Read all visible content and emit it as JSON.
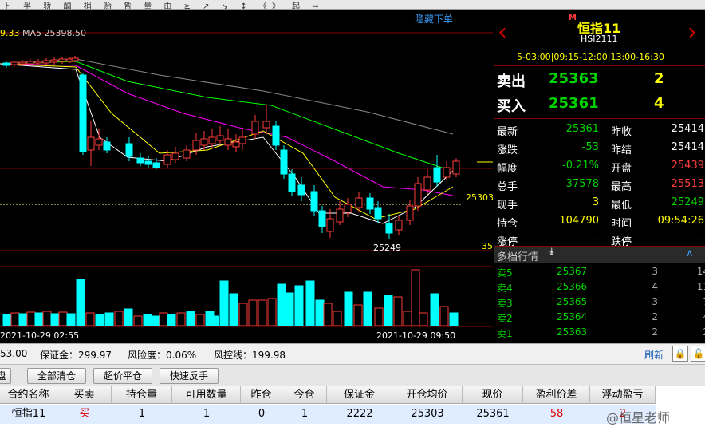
{
  "topbar": {
    "text": "卜 半 骄 酗 梢 贻 咎 量 由 ≥ ↗ ↘ ↕ 《》 起 ⇒"
  },
  "chart": {
    "ma_label_left": "9.33",
    "ma5_label": "MA5 25398.50",
    "hide_order_link": "隐藏下单",
    "price_line_label": "25303",
    "low_label": "25249",
    "right_edge_label": "35",
    "time_left": "2021-10-29 02:55",
    "time_right": "2021-10-29 09:50"
  },
  "quote": {
    "symbol_name": "恒指11",
    "symbol_badge": "M",
    "symbol_code": "HSI2111",
    "session_times": "5-03:00|09:15-12:00|13:00-16:30",
    "ask_label": "卖出",
    "ask_price": "25363",
    "ask_qty": "2",
    "bid_label": "买入",
    "bid_price": "25361",
    "bid_qty": "4",
    "stats": [
      {
        "l1": "最新",
        "v1": "25361",
        "l2": "昨收",
        "v2": "25414"
      },
      {
        "l1": "涨跌",
        "v1": "-53",
        "l2": "昨结",
        "v2": "25414"
      },
      {
        "l1": "幅度",
        "v1": "-0.21%",
        "l2": "开盘",
        "v2": "25439"
      },
      {
        "l1": "总手",
        "v1": "37578",
        "l2": "最高",
        "v2": "25513"
      },
      {
        "l1": "现手",
        "v1": "3",
        "l2": "最低",
        "v2": "25249"
      },
      {
        "l1": "持仓",
        "v1": "104790",
        "l2": "时间",
        "v2": "09:54:26"
      },
      {
        "l1": "涨停",
        "v1": "--",
        "l2": "跌停",
        "v2": "--"
      }
    ],
    "depth_title": "多档行情",
    "depth": [
      {
        "label": "卖5",
        "price": "25367",
        "qty": "3",
        "extra": "14"
      },
      {
        "label": "卖4",
        "price": "25366",
        "qty": "4",
        "extra": "11"
      },
      {
        "label": "卖3",
        "price": "25365",
        "qty": "3",
        "extra": "7"
      },
      {
        "label": "卖2",
        "price": "25364",
        "qty": "2",
        "extra": "4"
      },
      {
        "label": "卖1",
        "price": "25363",
        "qty": "2",
        "extra": "2"
      }
    ]
  },
  "status": {
    "balance": "53.00",
    "margin": "保证金：299.97",
    "risk": "风险度：0.06%",
    "control_line": "风控线：199.98",
    "refresh": "刷新"
  },
  "buttons": {
    "tab_cut": "盘",
    "close_all": "全部清仓",
    "over_price_close": "超价平仓",
    "quick_reverse": "快速反手"
  },
  "table": {
    "headers": [
      "合约名称",
      "买卖",
      "持仓量",
      "可用数量",
      "昨仓",
      "今仓",
      "保证金",
      "开仓均价",
      "现价",
      "盈利价差",
      "浮动盈亏"
    ],
    "row": [
      "恒指11",
      "买",
      "1",
      "1",
      "0",
      "1",
      "2222",
      "25303",
      "25361",
      "58",
      "2"
    ],
    "watermark": "@恒星老师"
  },
  "colors": {
    "up": "#ff3c3c",
    "down": "#00ffff",
    "ma5": "#ffffff",
    "ma10": "#ffff00",
    "ma20": "#ff00ff",
    "ma30": "#00ff00",
    "ma60": "#888888"
  }
}
